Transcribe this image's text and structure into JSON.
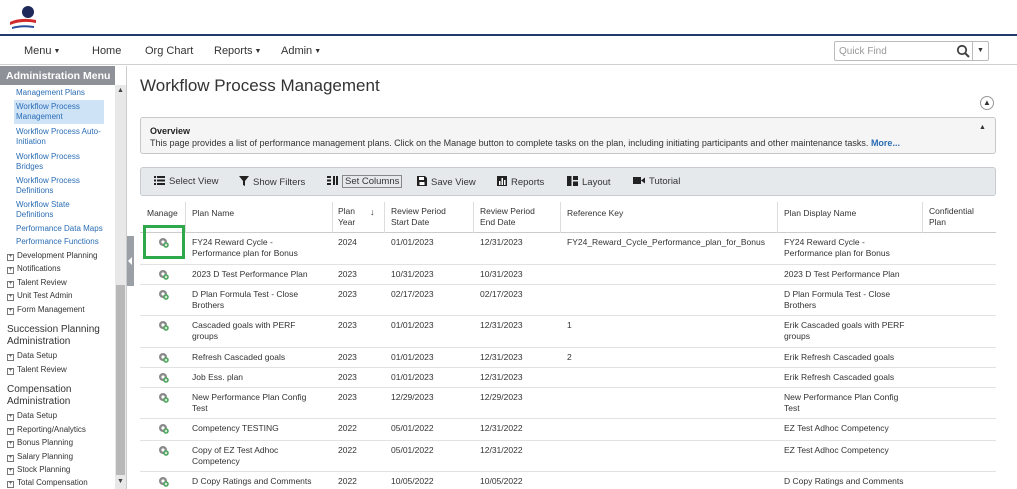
{
  "nav": {
    "menu": "Menu",
    "home": "Home",
    "org_chart": "Org Chart",
    "reports": "Reports",
    "admin": "Admin",
    "quick_find_placeholder": "Quick Find"
  },
  "sidebar": {
    "title": "Administration Menu",
    "links": [
      "Management Plans",
      "Workflow Process Management",
      "Workflow Process Auto-Initiation",
      "Workflow Process Bridges",
      "Workflow Process Definitions",
      "Workflow State Definitions",
      "Performance Data Maps",
      "Performance Functions"
    ],
    "perf_items": [
      "Development Planning",
      "Notifications",
      "Talent Review",
      "Unit Test Admin",
      "Form Management"
    ],
    "succession_title": "Succession Planning Administration",
    "succession_items": [
      "Data Setup",
      "Talent Review"
    ],
    "comp_title": "Compensation Administration",
    "comp_items": [
      "Data Setup",
      "Reporting/Analytics",
      "Bonus Planning",
      "Salary Planning",
      "Stock Planning",
      "Total Compensation"
    ]
  },
  "page": {
    "title": "Workflow Process Management",
    "overview_title": "Overview",
    "overview_text": "This page provides a list of performance management plans. Click on the Manage button to complete tasks on the plan, including initiating participants and other maintenance tasks.",
    "overview_more": "More..."
  },
  "toolbar": {
    "select_view": "Select View",
    "show_filters": "Show Filters",
    "set_columns": "Set Columns",
    "save_view": "Save View",
    "reports": "Reports",
    "layout": "Layout",
    "tutorial": "Tutorial"
  },
  "table": {
    "headers": {
      "manage": "Manage",
      "plan_name": "Plan Name",
      "plan_year_1": "Plan",
      "plan_year_2": "Year",
      "start_1": "Review Period",
      "start_2": "Start Date",
      "end_1": "Review Period",
      "end_2": "End Date",
      "ref_key": "Reference Key",
      "display_name": "Plan Display Name",
      "conf_1": "Confidential",
      "conf_2": "Plan"
    },
    "rows": [
      {
        "name": [
          "FY24 Reward Cycle -",
          "Performance plan for Bonus"
        ],
        "year": "2024",
        "start": "01/01/2023",
        "end": "12/31/2023",
        "ref": "FY24_Reward_Cycle_Performance_plan_for_Bonus",
        "display": [
          "FY24 Reward Cycle -",
          "Performance plan for Bonus"
        ]
      },
      {
        "name": [
          "2023 D Test Performance Plan"
        ],
        "year": "2023",
        "start": "10/31/2023",
        "end": "10/31/2023",
        "ref": "",
        "display": [
          "2023 D Test Performance Plan"
        ]
      },
      {
        "name": [
          "D Plan Formula Test - Close",
          "Brothers"
        ],
        "year": "2023",
        "start": "02/17/2023",
        "end": "02/17/2023",
        "ref": "",
        "display": [
          "D Plan Formula Test - Close",
          "Brothers"
        ]
      },
      {
        "name": [
          "Cascaded goals with PERF",
          "groups"
        ],
        "year": "2023",
        "start": "01/01/2023",
        "end": "12/31/2023",
        "ref": "1",
        "display": [
          "Erik Cascaded goals with PERF",
          "groups"
        ]
      },
      {
        "name": [
          "Refresh Cascaded goals"
        ],
        "year": "2023",
        "start": "01/01/2023",
        "end": "12/31/2023",
        "ref": "2",
        "display": [
          "Erik Refresh Cascaded goals"
        ]
      },
      {
        "name": [
          "Job Ess. plan"
        ],
        "year": "2023",
        "start": "01/01/2023",
        "end": "12/31/2023",
        "ref": "",
        "display": [
          "Erik Refresh Cascaded goals"
        ]
      },
      {
        "name": [
          "New Performance Plan Config",
          "Test"
        ],
        "year": "2023",
        "start": "12/29/2023",
        "end": "12/29/2023",
        "ref": "",
        "display": [
          "New Performance Plan Config",
          "Test"
        ]
      },
      {
        "name": [
          "Competency TESTING"
        ],
        "year": "2022",
        "start": "05/01/2022",
        "end": "12/31/2022",
        "ref": "",
        "display": [
          "EZ Test Adhoc Competency"
        ]
      },
      {
        "name": [
          "Copy of EZ Test Adhoc",
          "Competency"
        ],
        "year": "2022",
        "start": "05/01/2022",
        "end": "12/31/2022",
        "ref": "",
        "display": [
          "EZ Test Adhoc Competency"
        ]
      },
      {
        "name": [
          "D Copy Ratings and Comments"
        ],
        "year": "2022",
        "start": "10/05/2022",
        "end": "10/05/2022",
        "ref": "",
        "display": [
          "D Copy Ratings and Comments"
        ]
      }
    ]
  },
  "colors": {
    "accent_navy": "#1f3b6e",
    "link_blue": "#2a6db5",
    "highlight_green": "#2ea84a",
    "sidebar_header": "#8e9298"
  }
}
